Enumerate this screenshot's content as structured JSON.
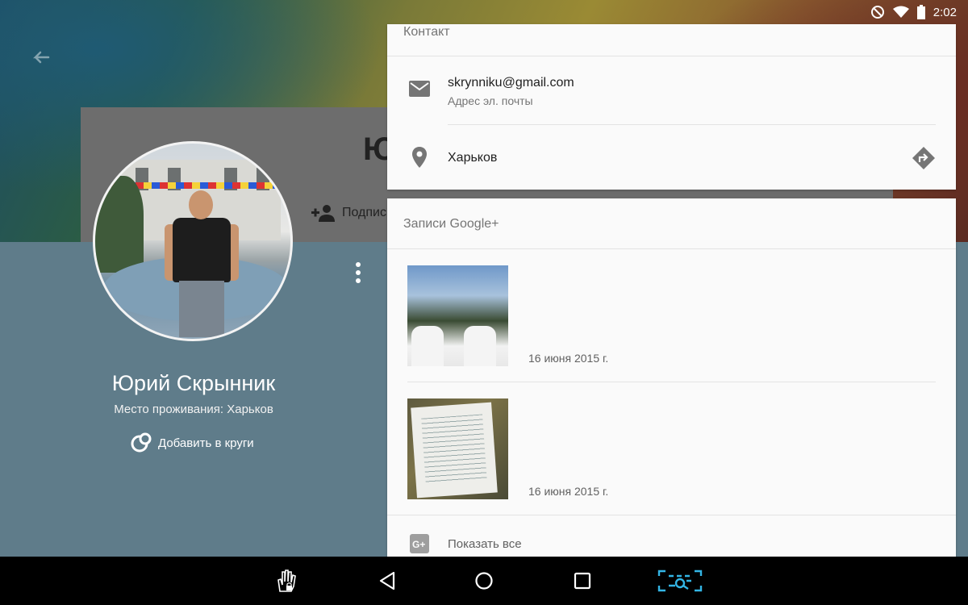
{
  "status_bar": {
    "time": "2:02"
  },
  "profile": {
    "header_initial": "Ю",
    "follow_label": "Подпис",
    "name": "Юрий Скрынник",
    "residence": "Место проживания: Харьков",
    "add_to_circles": "Добавить в круги"
  },
  "contact": {
    "title": "Контакт",
    "email": "skrynniku@gmail.com",
    "email_label": "Адрес эл. почты",
    "location": "Харьков"
  },
  "posts": {
    "title": "Записи Google+",
    "items": [
      {
        "date": "16 июня 2015 г."
      },
      {
        "date": "16 июня 2015 г."
      }
    ],
    "show_all": "Показать все"
  },
  "colors": {
    "lower_panel": "#5f7c8a",
    "accent_nav": "#33b5e5"
  }
}
